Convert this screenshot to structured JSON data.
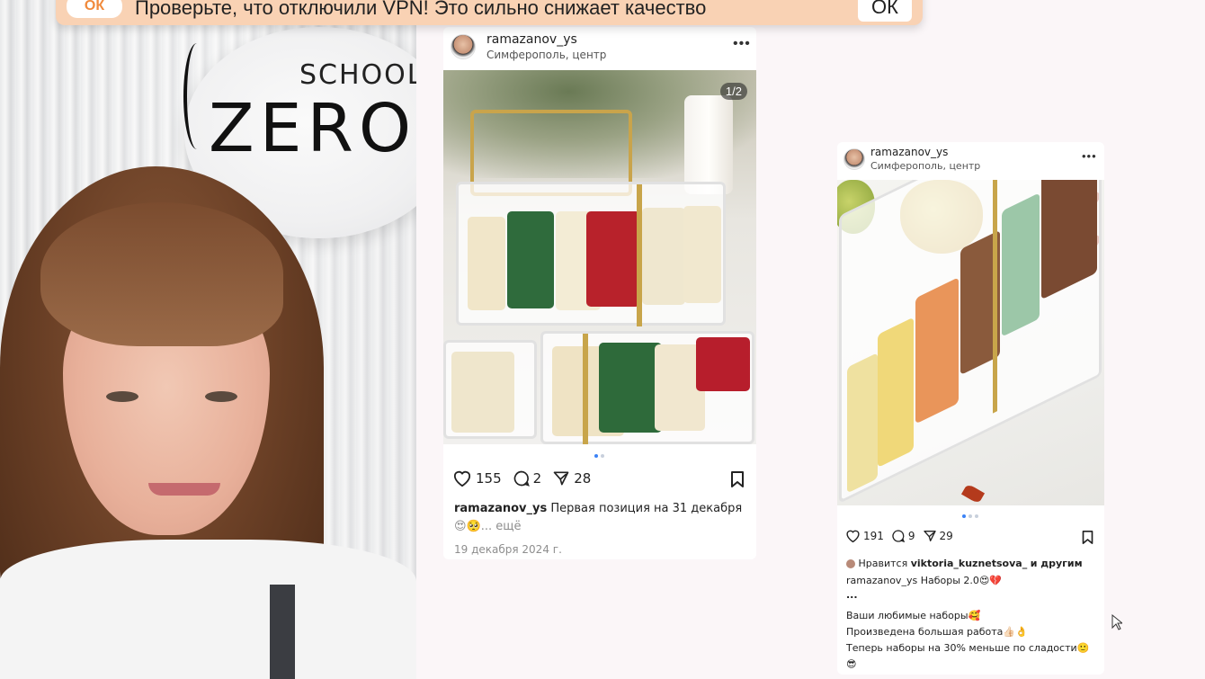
{
  "toast": {
    "icon_label": "ОК",
    "message": "Проверьте, что отключили VPN! Это сильно снижает качество",
    "ok_label": "ОК"
  },
  "webcam": {
    "logo_school": "SCHOOL",
    "logo_zero": "ZERO"
  },
  "post1": {
    "username": "ramazanov_ys",
    "location": "Симферополь, центр",
    "more_icon": "more-horizontal-icon",
    "photo_counter": "1/2",
    "likes": "155",
    "comments": "2",
    "shares": "28",
    "caption_user": "ramazanov_ys",
    "caption_text": "Первая позиция на 31 декабря",
    "caption_more": "😍🥺... ещё",
    "date": "19 декабря 2024 г."
  },
  "post2": {
    "username": "ramazanov_ys",
    "location": "Симферополь, центр",
    "more_icon": "more-horizontal-icon",
    "likes": "191",
    "comments": "9",
    "shares": "29",
    "liked_by_prefix": "Нравится",
    "liked_by_user": "viktoria_kuznetsova_",
    "liked_by_suffix": "и другим",
    "caption_user": "ramazanov_ys",
    "caption_text": "Наборы 2.0😍💔",
    "caption_ellipsis": "...",
    "caption_lines": [
      "Ваши любимые наборы🥰",
      "Произведена большая работа👍🏻👌",
      "Теперь наборы на 30% меньше по сладости🙂",
      "😎"
    ]
  },
  "colors": {
    "toast_bg": "#f9d2b4",
    "page_bg": "#fbf6f8",
    "dot_active": "#3b82f6"
  }
}
